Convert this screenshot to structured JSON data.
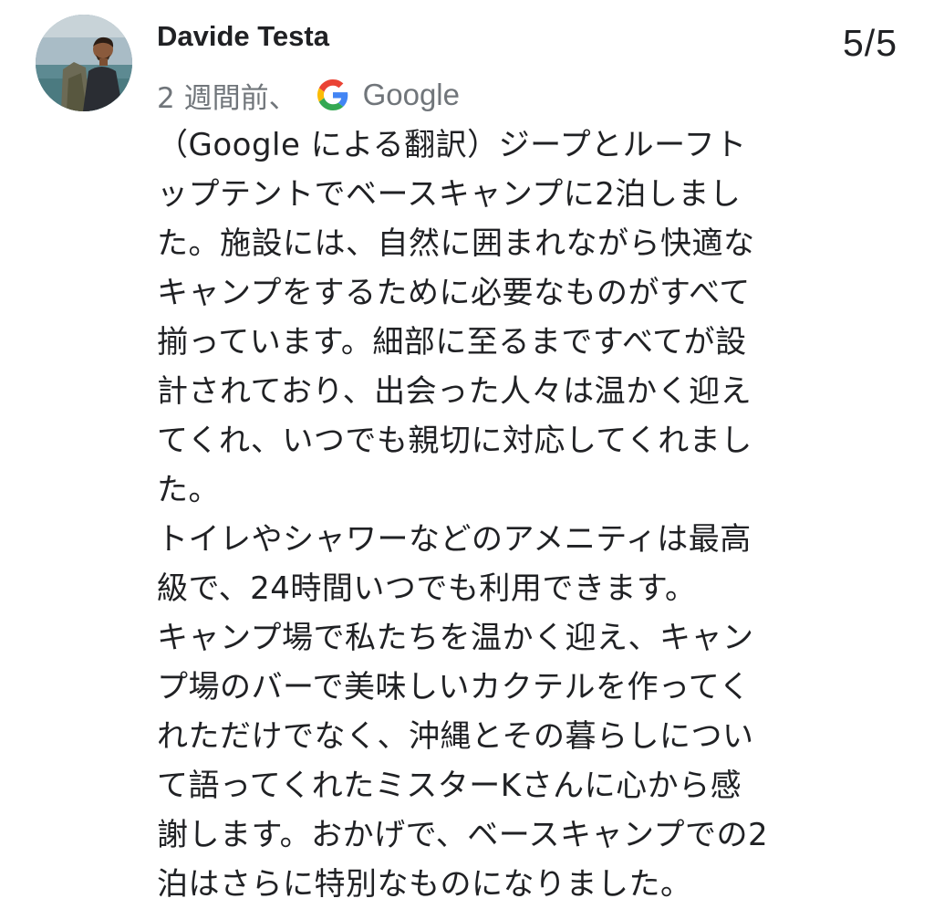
{
  "review": {
    "reviewer_name": "Davide Testa",
    "page_counter": "5/5",
    "time_ago": "2 週間前、",
    "source_label": "Google",
    "source_icon": "google-g-icon",
    "lines": [
      "（Google による翻訳）ジープとルーフト",
      "ップテントでベースキャンプに2泊しまし",
      "た。施設には、自然に囲まれながら快適な",
      "キャンプをするために必要なものがすべて",
      "揃っています。細部に至るまですべてが設",
      "計されており、出会った人々は温かく迎え",
      "てくれ、いつでも親切に対応してくれまし",
      "た。",
      "トイレやシャワーなどのアメニティは最高",
      "級で、24時間いつでも利用できます。",
      "キャンプ場で私たちを温かく迎え、キャン",
      "プ場のバーで美味しいカクテルを作ってく",
      "れただけでなく、沖縄とその暮らしについ",
      "て語ってくれたミスターKさんに心から感",
      "謝します。おかげで、ベースキャンプでの2",
      "泊はさらに特別なものになりました。"
    ]
  },
  "colors": {
    "text_primary": "#202124",
    "text_secondary": "#70757a",
    "google_blue": "#4285F4",
    "google_red": "#EA4335",
    "google_yellow": "#FBBC05",
    "google_green": "#34A853"
  }
}
